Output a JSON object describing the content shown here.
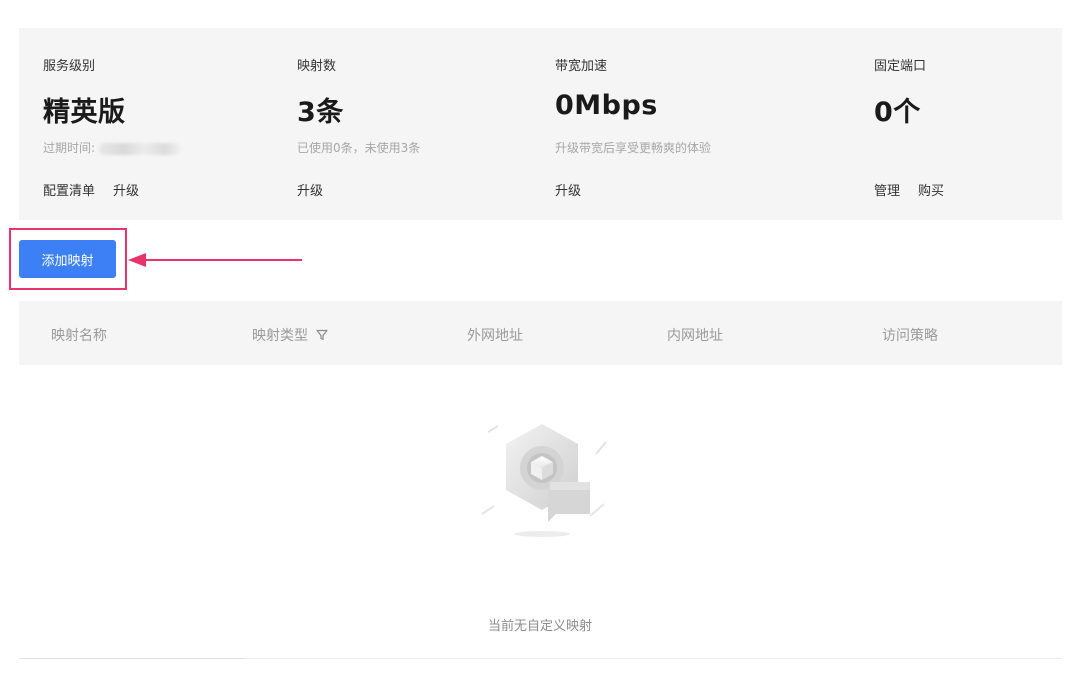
{
  "summary": {
    "service_level": {
      "label": "服务级别",
      "value": "精英版",
      "sub_prefix": "过期时间:",
      "actions": [
        "配置清单",
        "升级"
      ]
    },
    "mappings": {
      "label": "映射数",
      "value": "3条",
      "sub": "已使用0条，未使用3条",
      "actions": [
        "升级"
      ]
    },
    "bandwidth": {
      "label": "带宽加速",
      "value": "0Mbps",
      "sub": "升级带宽后享受更畅爽的体验",
      "actions": [
        "升级"
      ]
    },
    "fixed_port": {
      "label": "固定端口",
      "value": "0个",
      "actions": [
        "管理",
        "购买"
      ]
    }
  },
  "add_button": {
    "label": "添加映射"
  },
  "table": {
    "columns": [
      "映射名称",
      "映射类型",
      "外网地址",
      "内网地址",
      "访问策略"
    ]
  },
  "empty_state": {
    "text": "当前无自定义映射",
    "icon": "empty-box-icon"
  },
  "colors": {
    "primary": "#3d80f6",
    "highlight": "#e8336d",
    "panel_bg": "#f5f5f5"
  }
}
